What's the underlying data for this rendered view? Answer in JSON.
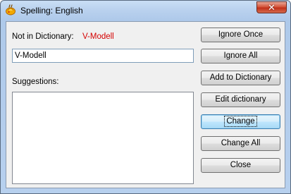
{
  "window": {
    "title": "Spelling: English",
    "close_glyph": "✕",
    "app_icon": "spelling-app-icon"
  },
  "labels": {
    "not_in_dictionary": "Not in Dictionary:",
    "suggestions": "Suggestions:"
  },
  "misspelled_word": "V-Modell",
  "edit_field": {
    "value": "V-Modell",
    "placeholder": ""
  },
  "suggestions": [],
  "buttons": {
    "ignore_once": "Ignore Once",
    "ignore_all": "Ignore All",
    "add_to_dictionary": "Add to Dictionary",
    "edit_dictionary": "Edit dictionary",
    "change": "Change",
    "change_all": "Change All",
    "close": "Close"
  },
  "colors": {
    "misspelled_word": "#d40000",
    "close_button": "#c1301a",
    "default_button_border": "#3c7fb1"
  }
}
